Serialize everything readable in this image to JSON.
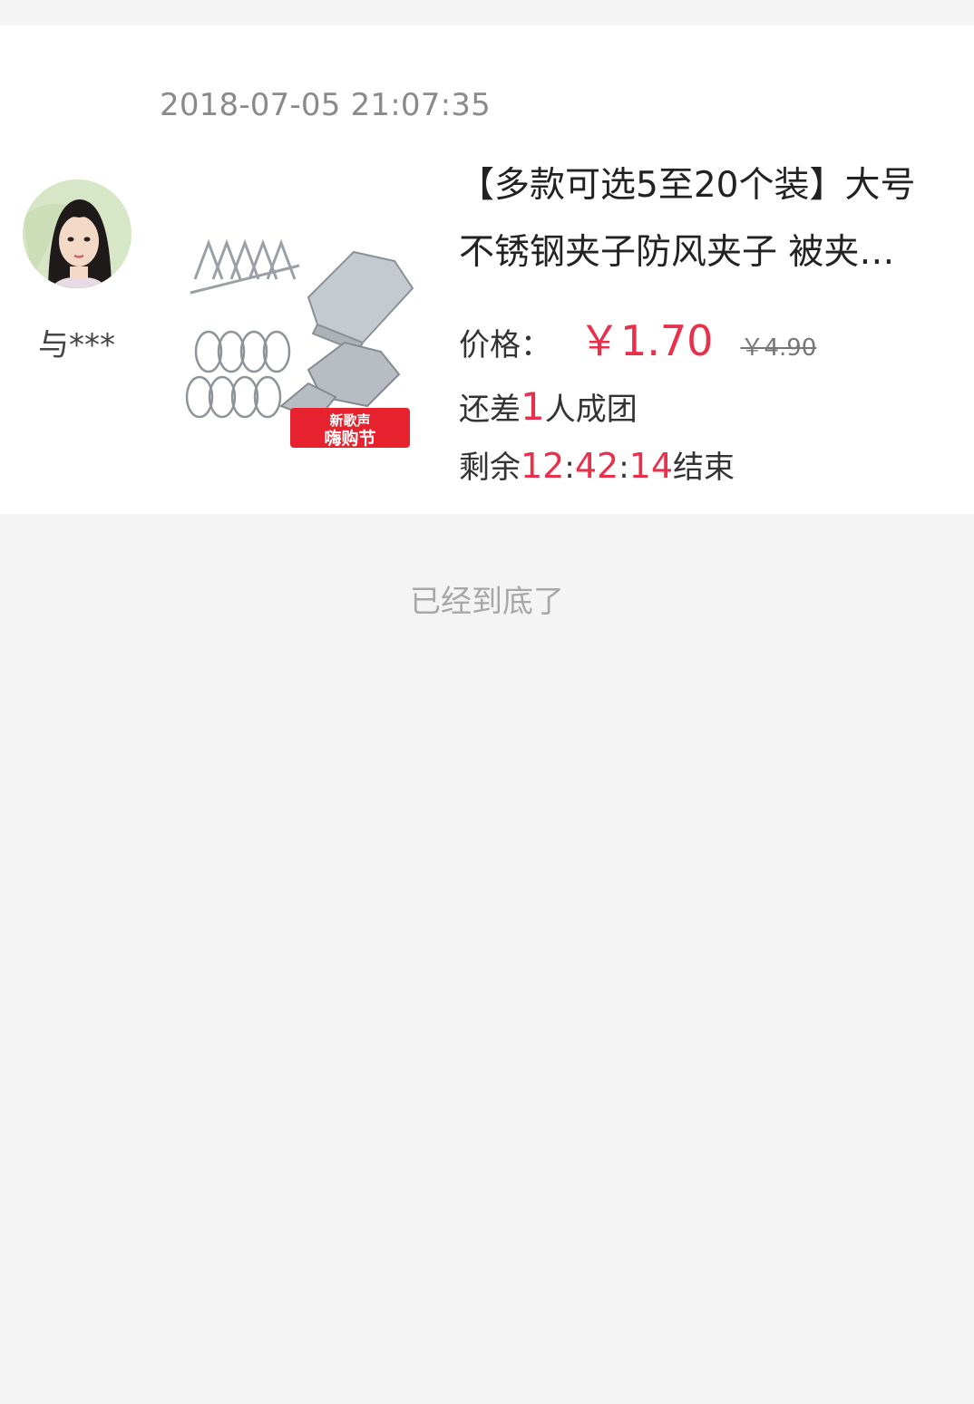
{
  "order": {
    "timestamp": "2018-07-05 21:07:35",
    "user": {
      "nickname": "与***",
      "avatar_icon": "user-avatar"
    },
    "product": {
      "image_icon": "clothespin-product-image",
      "title_line1": "【多款可选5至20个装】大号",
      "title_line2": "不锈钢夹子防风夹子 被夹…",
      "price_label": "价格：",
      "price_now": "￥1.70",
      "price_original": "￥4.90",
      "image_badge_line1": "新歌声",
      "image_badge_line2": "嗨购节"
    },
    "group": {
      "prefix": "还差",
      "remaining_people": "1",
      "suffix": "人成团"
    },
    "countdown": {
      "prefix": "剩余",
      "hours": "12",
      "minutes": "42",
      "seconds": "14",
      "separator": ":",
      "suffix": "结束"
    }
  },
  "footer": {
    "end_text": "已经到底了"
  },
  "colors": {
    "accent": "#e8304a",
    "background": "#f4f4f4",
    "card": "#ffffff",
    "muted": "#8a8a8a"
  }
}
